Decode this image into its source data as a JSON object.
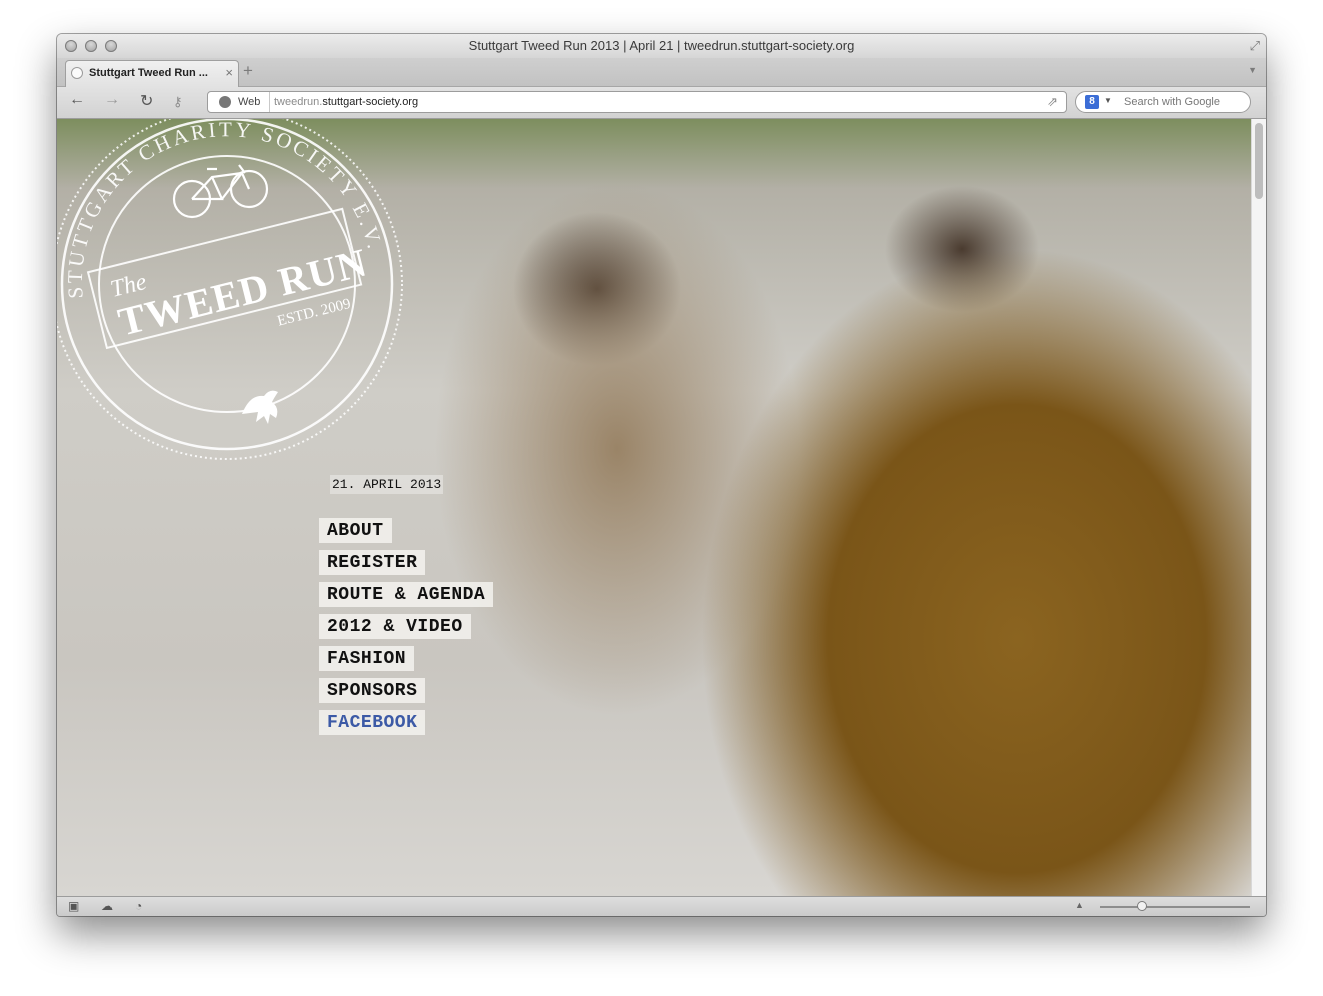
{
  "window": {
    "title": "Stuttgart Tweed Run 2013 | April 21 | tweedrun.stuttgart-society.org"
  },
  "tab": {
    "title": "Stuttgart Tweed Run ...",
    "close": "×",
    "new_tab": "+"
  },
  "toolbar": {
    "back": "←",
    "forward": "→",
    "reload": "↻",
    "keys": "⚷"
  },
  "address": {
    "scheme_label": "Web",
    "url_prefix": "tweedrun.",
    "url_domain": "stuttgart-society.org"
  },
  "search": {
    "engine_icon": "8",
    "placeholder": "Search with Google"
  },
  "page": {
    "date": "21. APRIL 2013",
    "logo": {
      "ring_text": "STUTTGART CHARITY SOCIETY E.V.",
      "word_the": "The",
      "word_main": "TWEED RUN",
      "estd": "ESTD. 2009"
    },
    "nav": [
      "ABOUT",
      "REGISTER",
      "ROUTE & AGENDA",
      "2012 & VIDEO",
      "FASHION",
      "SPONSORS",
      "FACEBOOK"
    ]
  },
  "colors": {
    "facebook_link": "#3c5aa6",
    "nav_text": "#111111"
  }
}
